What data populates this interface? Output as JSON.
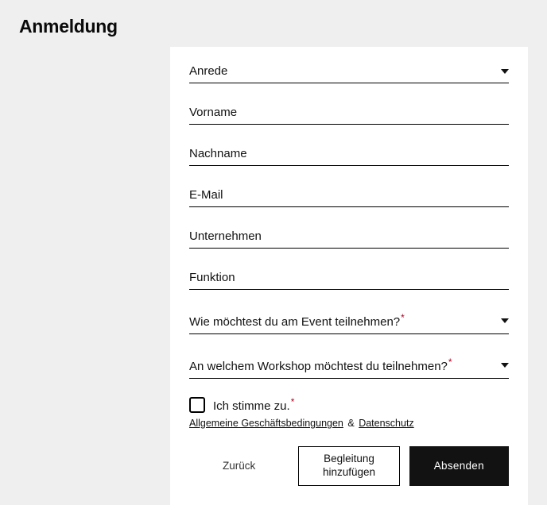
{
  "page": {
    "title": "Anmeldung"
  },
  "form": {
    "fields": {
      "salutation": {
        "label": "Anrede"
      },
      "firstname": {
        "label": "Vorname"
      },
      "lastname": {
        "label": "Nachname"
      },
      "email": {
        "label": "E-Mail"
      },
      "company": {
        "label": "Unternehmen"
      },
      "role": {
        "label": "Funktion"
      },
      "attendance": {
        "label": "Wie möchtest du am Event teilnehmen?",
        "required": "*"
      },
      "workshop": {
        "label": "An welchem Workshop möchtest du teilnehmen?",
        "required": "*"
      }
    },
    "consent": {
      "label": "Ich stimme zu.",
      "required": "*",
      "terms_link": "Allgemeine Geschäftsbedingungen",
      "amp": "&",
      "privacy_link": "Datenschutz"
    },
    "buttons": {
      "back": "Zurück",
      "add_companion": "Begleitung hinzufügen",
      "submit": "Absenden"
    }
  }
}
